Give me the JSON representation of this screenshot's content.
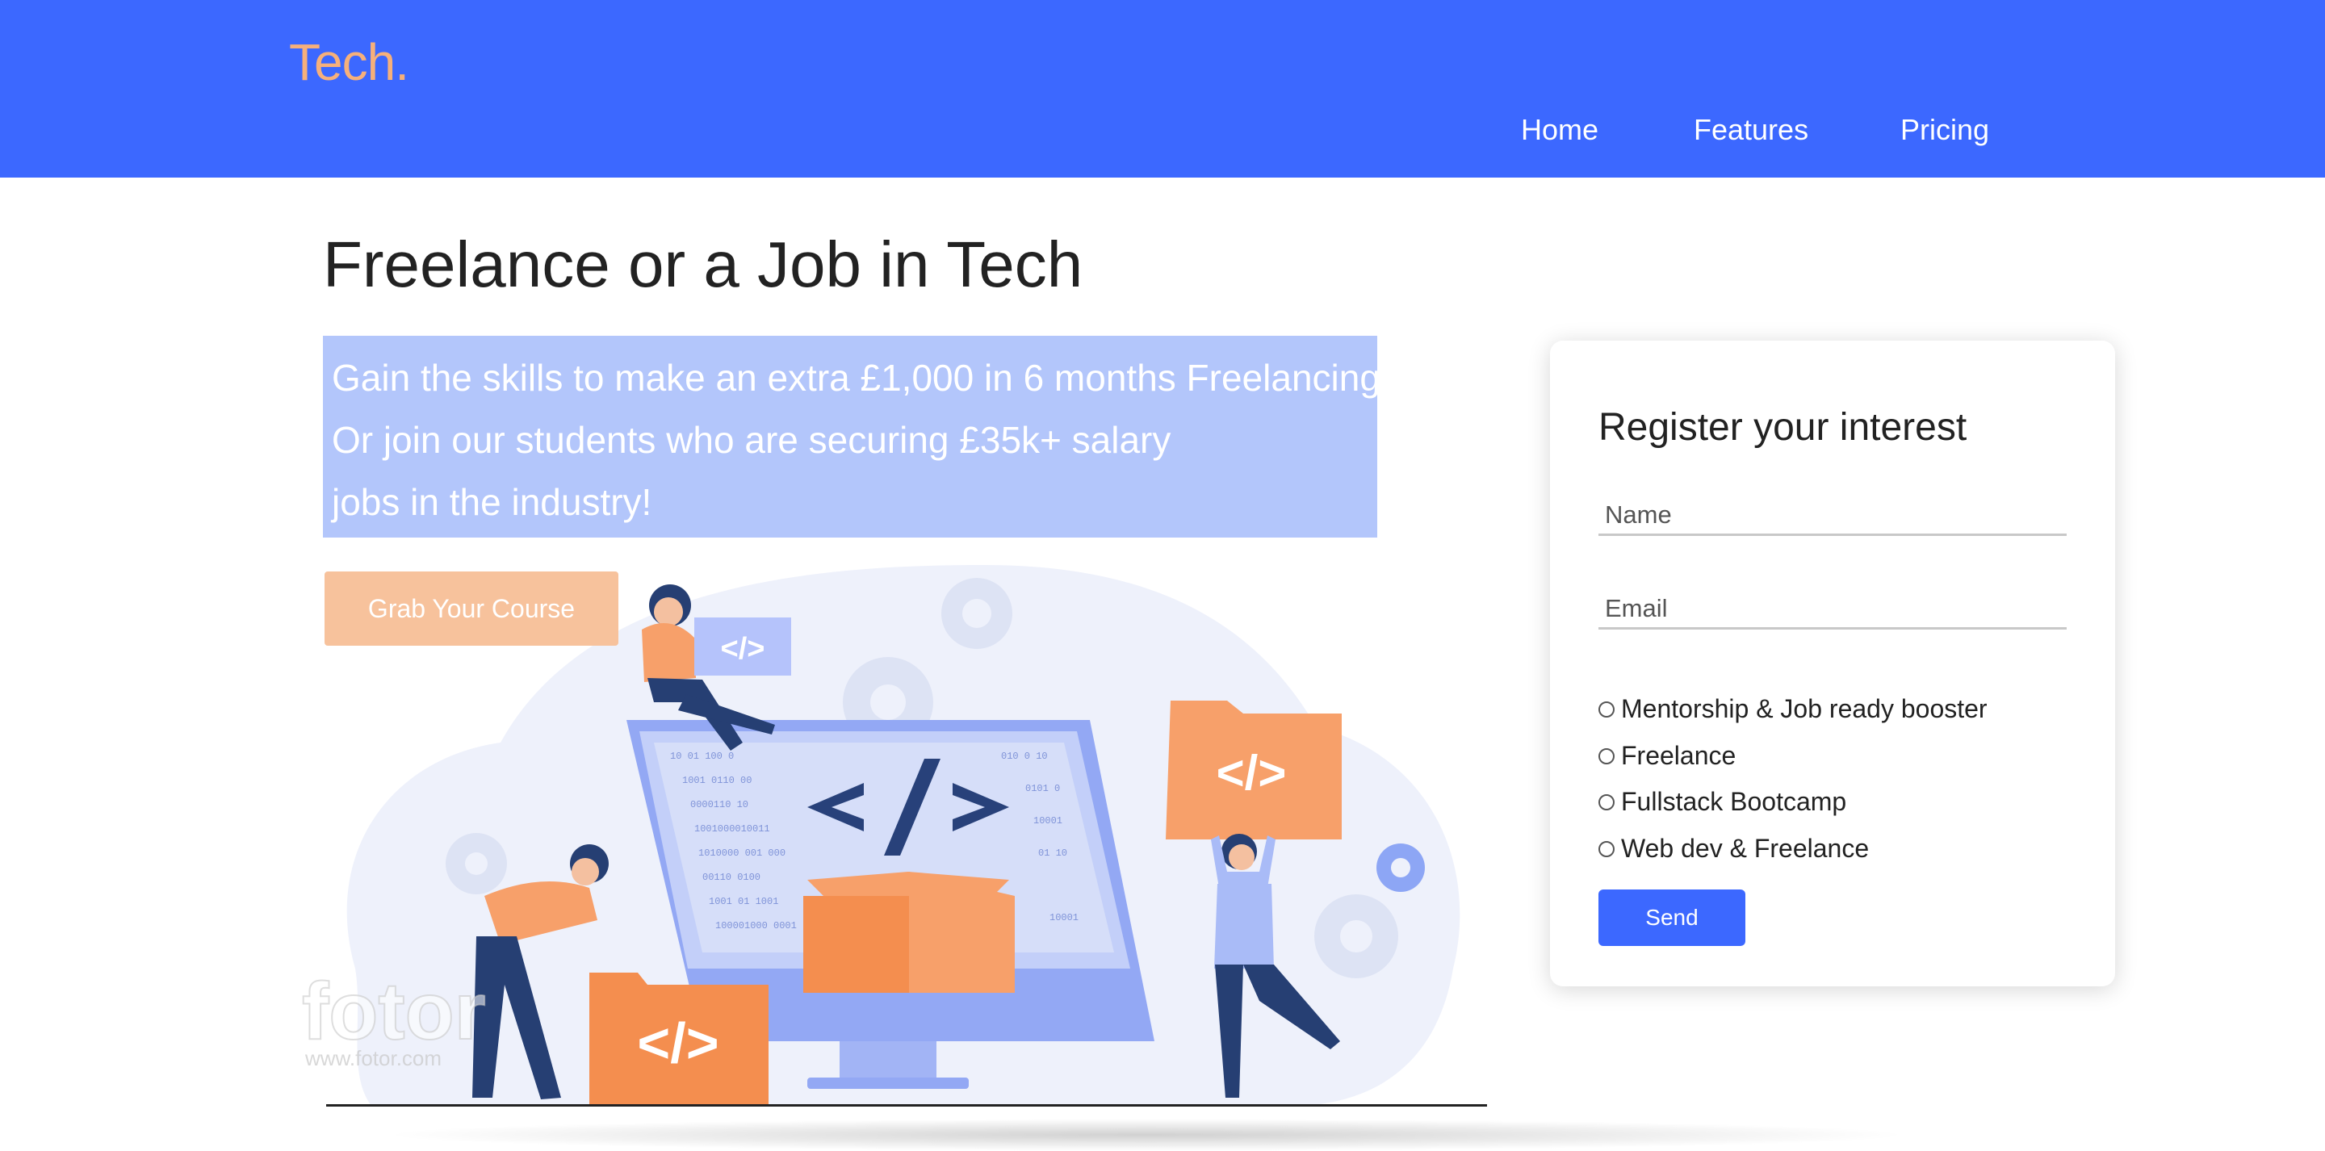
{
  "header": {
    "logo": "Tech.",
    "nav": [
      {
        "label": "Home"
      },
      {
        "label": "Features"
      },
      {
        "label": "Pricing"
      }
    ]
  },
  "hero": {
    "title": "Freelance or a Job in Tech",
    "subtitle_lines": [
      "Gain the skills to make an extra £1,000 in 6 months Freelancing.",
      "Or join our students who are securing £35k+ salary",
      "jobs in the industry!"
    ],
    "cta_label": "Grab Your Course",
    "watermark": "fotor",
    "watermark_url": "www.fotor.com"
  },
  "form": {
    "title": "Register your interest",
    "name_placeholder": "Name",
    "email_placeholder": "Email",
    "options": [
      {
        "label": "Mentorship & Job ready booster"
      },
      {
        "label": "Freelance"
      },
      {
        "label": "Fullstack Bootcamp"
      },
      {
        "label": "Web dev & Freelance"
      }
    ],
    "send_label": "Send"
  },
  "colors": {
    "brand_blue": "#3c68ff",
    "accent_orange": "#f7a06a",
    "highlight": "#b3c6fb"
  }
}
